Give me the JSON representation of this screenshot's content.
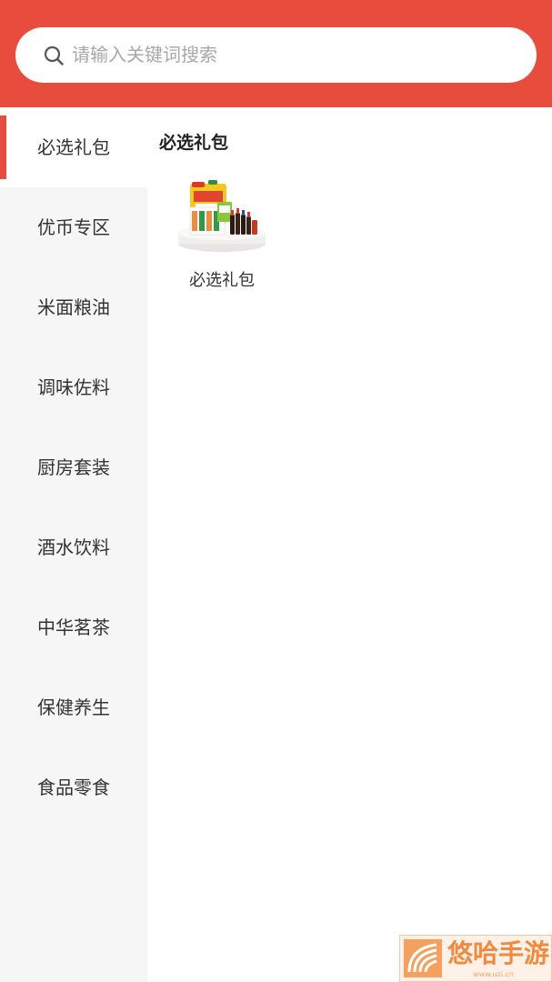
{
  "search": {
    "placeholder": "请输入关键词搜索",
    "icon": "search-icon"
  },
  "sidebar": {
    "items": [
      {
        "label": "必选礼包",
        "active": true
      },
      {
        "label": "优币专区",
        "active": false
      },
      {
        "label": "米面粮油",
        "active": false
      },
      {
        "label": "调味佐料",
        "active": false
      },
      {
        "label": "厨房套装",
        "active": false
      },
      {
        "label": "酒水饮料",
        "active": false
      },
      {
        "label": "中华茗茶",
        "active": false
      },
      {
        "label": "保健养生",
        "active": false
      },
      {
        "label": "食品零食",
        "active": false
      }
    ]
  },
  "content": {
    "title": "必选礼包",
    "products": [
      {
        "label": "必选礼包",
        "image": "gift-pack-image"
      }
    ]
  },
  "watermark": {
    "text": "悠哈手游",
    "sub": "www.uzi.cn"
  },
  "colors": {
    "accent": "#e84c3d",
    "sidebar_bg": "#f6f6f6",
    "placeholder": "#a8a8a8"
  }
}
